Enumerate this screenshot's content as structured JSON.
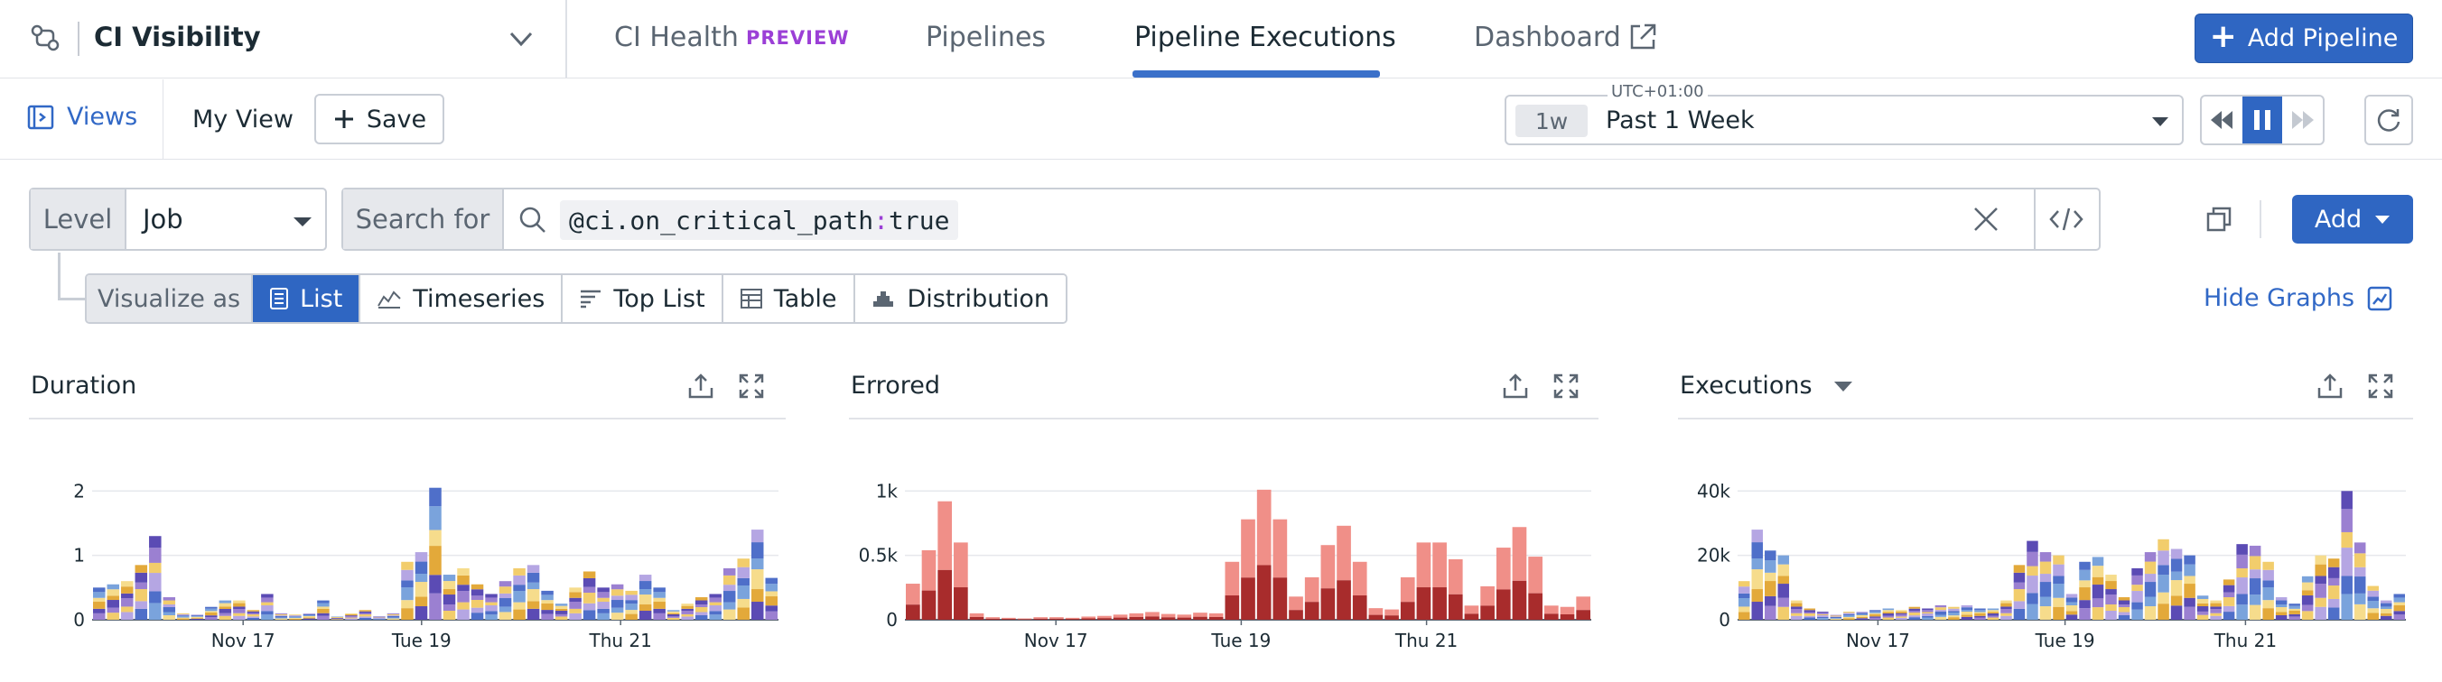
{
  "app": {
    "title": "CI Visibility",
    "tabs": [
      {
        "label": "CI Health",
        "badge": "PREVIEW"
      },
      {
        "label": "Pipelines"
      },
      {
        "label": "Pipeline Executions",
        "active": true
      },
      {
        "label": "Dashboard"
      }
    ],
    "add_pipeline_label": "Add Pipeline"
  },
  "viewbar": {
    "views_label": "Views",
    "my_view_label": "My View",
    "save_label": "Save",
    "timezone": "UTC+01:00",
    "time_chip": "1w",
    "time_range": "Past 1 Week"
  },
  "query": {
    "level_label": "Level",
    "level_value": "Job",
    "search_label": "Search for",
    "query_key": "@ci.on_critical_path",
    "query_sep": ":",
    "query_value": "true",
    "add_label": "Add"
  },
  "visualize": {
    "label": "Visualize as",
    "options": [
      "List",
      "Timeseries",
      "Top List",
      "Table",
      "Distribution"
    ],
    "selected": "List",
    "hide_graphs_label": "Hide Graphs"
  },
  "colors": {
    "accent": "#2f66c2",
    "preview": "#9b3fd6",
    "stack_palette": [
      "#9b80d1",
      "#4f6fc9",
      "#e3a93a",
      "#f2cd6c",
      "#7aa3dc",
      "#5b4bb4",
      "#b5a6e3",
      "#f6dc8c"
    ],
    "error_light": "#f08f88",
    "error_dark": "#a82c2c"
  },
  "panels": [
    {
      "title": "Duration",
      "chart_data": {
        "type": "bar",
        "stacked": true,
        "x_tick_labels": [
          "Nov 17",
          "Tue 19",
          "Thu 21"
        ],
        "y_tick_labels": [
          "0",
          "1",
          "2"
        ],
        "ylim": [
          0,
          2.2
        ],
        "values": [
          0.5,
          0.55,
          0.6,
          0.85,
          1.3,
          0.35,
          0.1,
          0.08,
          0.2,
          0.3,
          0.3,
          0.15,
          0.4,
          0.1,
          0.08,
          0.1,
          0.3,
          0.05,
          0.1,
          0.15,
          0.05,
          0.1,
          0.9,
          1.05,
          2.05,
          0.7,
          0.8,
          0.55,
          0.4,
          0.6,
          0.8,
          0.85,
          0.45,
          0.25,
          0.5,
          0.75,
          0.5,
          0.55,
          0.45,
          0.7,
          0.5,
          0.15,
          0.25,
          0.35,
          0.4,
          0.8,
          0.95,
          1.4,
          0.65
        ]
      }
    },
    {
      "title": "Errored",
      "chart_data": {
        "type": "bar",
        "stacked": true,
        "x_tick_labels": [
          "Nov 17",
          "Tue 19",
          "Thu 21"
        ],
        "y_tick_labels": [
          "0",
          "0.5k",
          "1k"
        ],
        "ylim": [
          0,
          1100
        ],
        "values": [
          280,
          540,
          920,
          600,
          50,
          20,
          15,
          10,
          20,
          20,
          15,
          25,
          30,
          40,
          50,
          60,
          45,
          40,
          55,
          50,
          450,
          780,
          1010,
          780,
          180,
          330,
          580,
          730,
          450,
          90,
          80,
          330,
          600,
          600,
          470,
          110,
          260,
          560,
          720,
          490,
          110,
          100,
          180
        ]
      }
    },
    {
      "title": "Executions",
      "has_dropdown": true,
      "chart_data": {
        "type": "bar",
        "stacked": true,
        "x_tick_labels": [
          "Nov 17",
          "Tue 19",
          "Thu 21"
        ],
        "y_tick_labels": [
          "0",
          "20k",
          "40k"
        ],
        "ylim": [
          0,
          44000
        ],
        "values": [
          12000,
          28000,
          21500,
          20000,
          6000,
          3500,
          2500,
          1500,
          2500,
          2500,
          3000,
          3500,
          3000,
          4000,
          3500,
          4500,
          4000,
          4500,
          3500,
          3500,
          6000,
          17000,
          24500,
          21000,
          20000,
          8000,
          18000,
          19500,
          14000,
          7000,
          16000,
          21000,
          25000,
          22000,
          20000,
          7500,
          6000,
          12500,
          23500,
          23000,
          18000,
          7000,
          5000,
          13500,
          20000,
          19000,
          40000,
          24000,
          10500,
          6000,
          8000
        ]
      }
    }
  ]
}
